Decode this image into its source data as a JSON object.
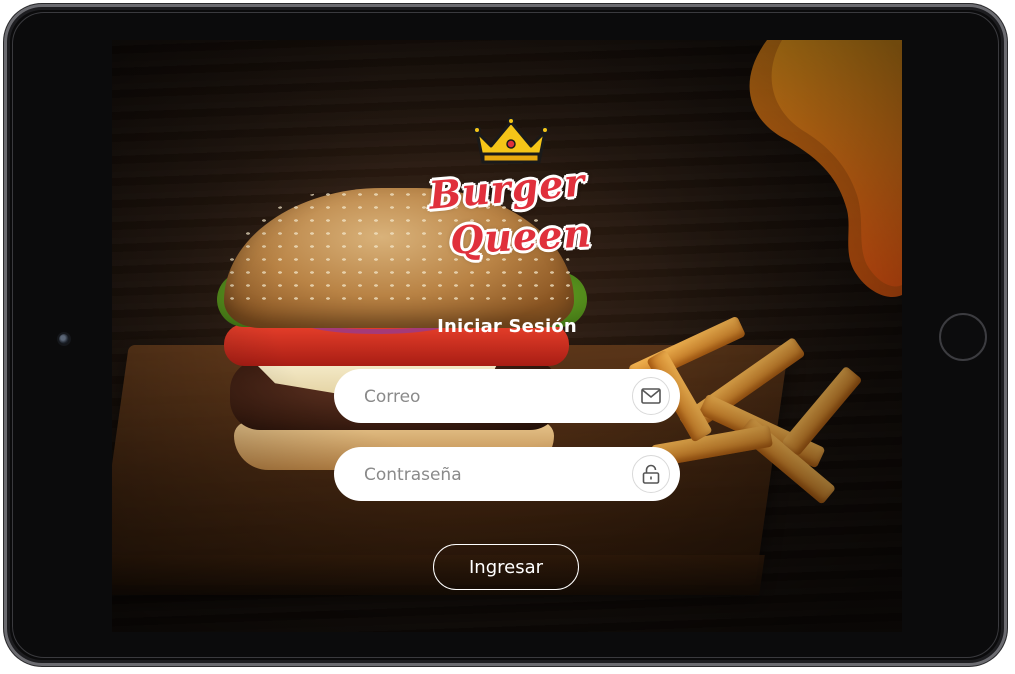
{
  "brand": {
    "name_line1": "Burger",
    "name_line2": "Queen",
    "accent_color": "#e0303c",
    "blob_color": "#f7941d"
  },
  "login": {
    "title": "Iniciar Sesión",
    "email": {
      "placeholder": "Correo",
      "value": "",
      "icon": "mail-icon"
    },
    "password": {
      "placeholder": "Contraseña",
      "value": "",
      "icon": "unlock-icon"
    },
    "submit_label": "Ingresar"
  }
}
